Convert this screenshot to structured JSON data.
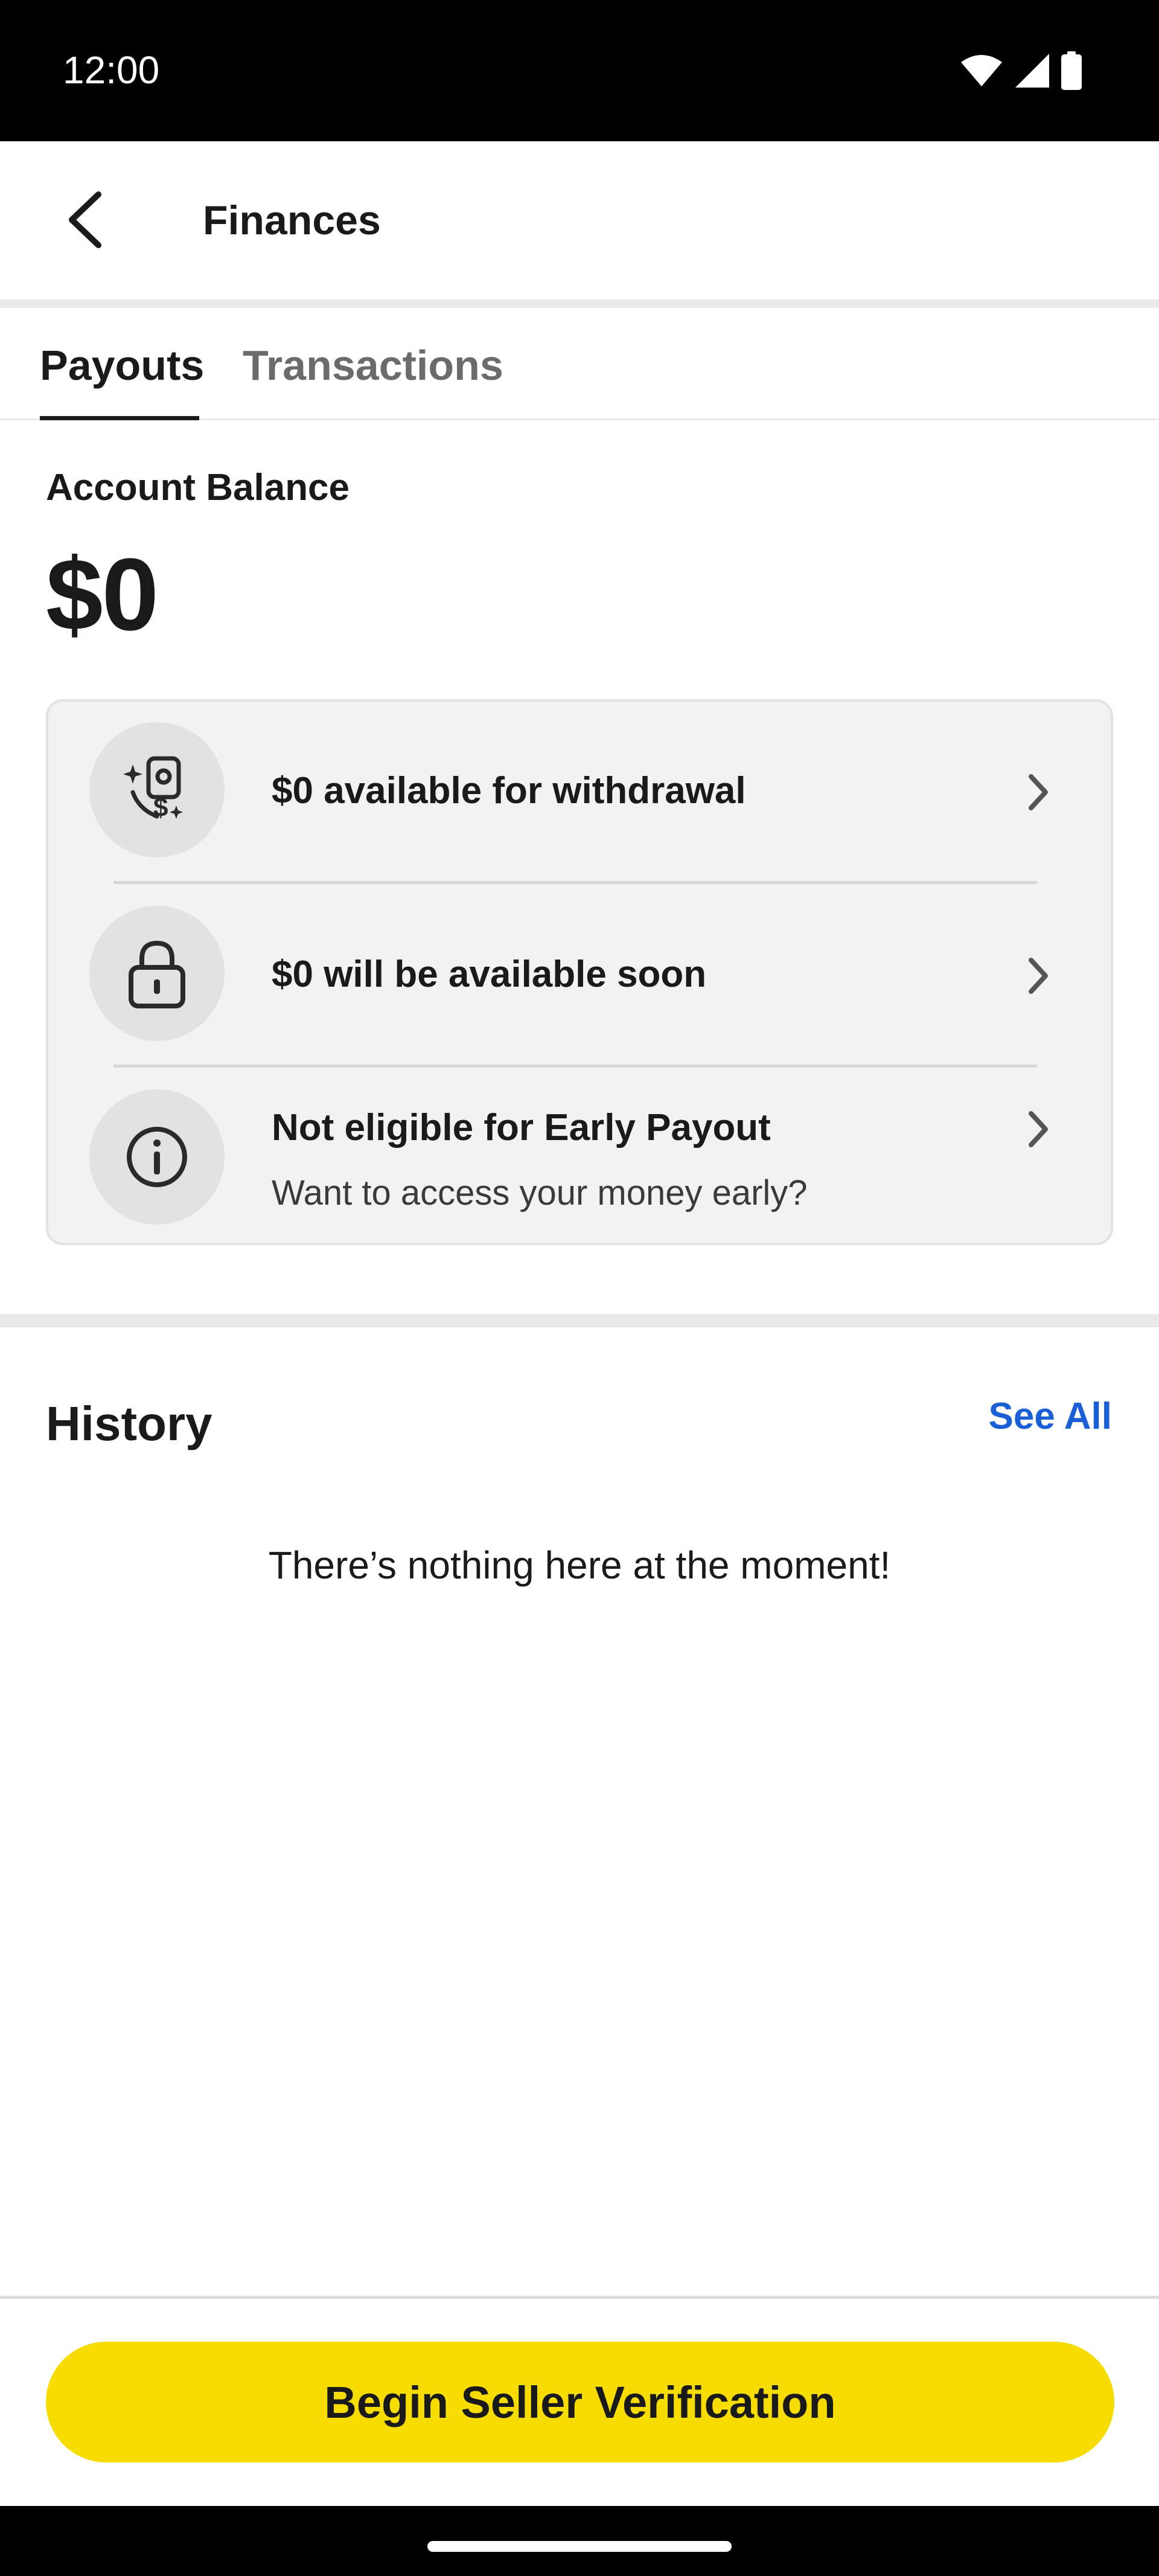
{
  "status_bar": {
    "time": "12:00",
    "icons": [
      "wifi-icon",
      "cellular-signal-icon",
      "battery-icon"
    ]
  },
  "app_bar": {
    "title": "Finances",
    "back_icon": "back-arrow-icon"
  },
  "tabs": [
    {
      "label": "Payouts",
      "selected": true
    },
    {
      "label": "Transactions",
      "selected": false
    }
  ],
  "balance": {
    "label": "Account Balance",
    "amount": "$0"
  },
  "payout_rows": [
    {
      "icon": "money-sparkle-icon",
      "title": "$0 available for withdrawal",
      "subtitle": ""
    },
    {
      "icon": "lock-icon",
      "title": "$0 will be available soon",
      "subtitle": ""
    },
    {
      "icon": "info-icon",
      "title": "Not eligible for Early Payout",
      "subtitle": "Want to access your money early?"
    }
  ],
  "history": {
    "title": "History",
    "see_all": "See All",
    "empty_message": "There’s nothing here at the moment!"
  },
  "cta": {
    "label": "Begin Seller Verification"
  },
  "colors": {
    "accent_yellow": "#f7dc00",
    "link_blue": "#1a5fd6",
    "card_bg": "#f2f2f2"
  }
}
